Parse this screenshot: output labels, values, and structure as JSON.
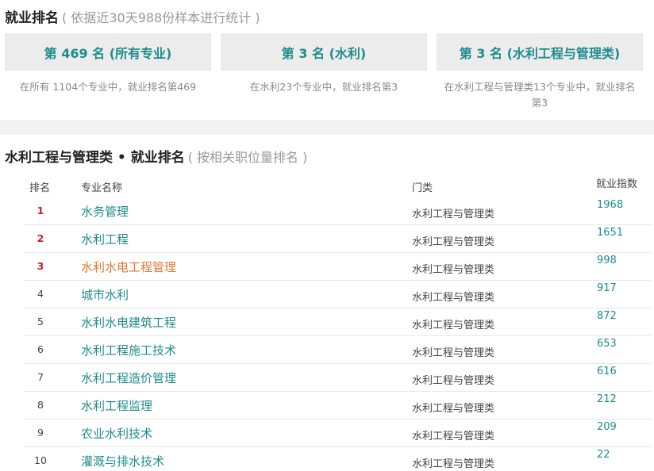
{
  "summary": {
    "title": "就业排名",
    "subtitle": "( 依据近30天988份样本进行统计 )",
    "cards": [
      {
        "label": "第 469 名 (所有专业)",
        "desc": "在所有 1104个专业中，就业排名第469"
      },
      {
        "label": "第 3 名 (水利)",
        "desc": "在水利23个专业中，就业排名第3"
      },
      {
        "label": "第 3 名 (水利工程与管理类)",
        "desc": "在水利工程与管理类13个专业中，就业排名第3"
      }
    ]
  },
  "ranking": {
    "title": "水利工程与管理类 • 就业排名",
    "subtitle": "( 按相关职位量排名 )",
    "headers": {
      "rank": "排名",
      "name": "专业名称",
      "category": "门类",
      "index": "就业指数"
    },
    "rows": [
      {
        "rank": "1",
        "name": "水务管理",
        "category": "水利工程与管理类",
        "index": "1968"
      },
      {
        "rank": "2",
        "name": "水利工程",
        "category": "水利工程与管理类",
        "index": "1651"
      },
      {
        "rank": "3",
        "name": "水利水电工程管理",
        "category": "水利工程与管理类",
        "index": "998"
      },
      {
        "rank": "4",
        "name": "城市水利",
        "category": "水利工程与管理类",
        "index": "917"
      },
      {
        "rank": "5",
        "name": "水利水电建筑工程",
        "category": "水利工程与管理类",
        "index": "872"
      },
      {
        "rank": "6",
        "name": "水利工程施工技术",
        "category": "水利工程与管理类",
        "index": "653"
      },
      {
        "rank": "7",
        "name": "水利工程造价管理",
        "category": "水利工程与管理类",
        "index": "616"
      },
      {
        "rank": "8",
        "name": "水利工程监理",
        "category": "水利工程与管理类",
        "index": "212"
      },
      {
        "rank": "9",
        "name": "农业水利技术",
        "category": "水利工程与管理类",
        "index": "209"
      },
      {
        "rank": "10",
        "name": "灌溉与排水技术",
        "category": "水利工程与管理类",
        "index": "22"
      }
    ]
  },
  "colors": {
    "accent": "#1e8c8c",
    "highlight": "#e8772e",
    "top_rank": "#c0232b",
    "card_bg": "#ececec"
  }
}
